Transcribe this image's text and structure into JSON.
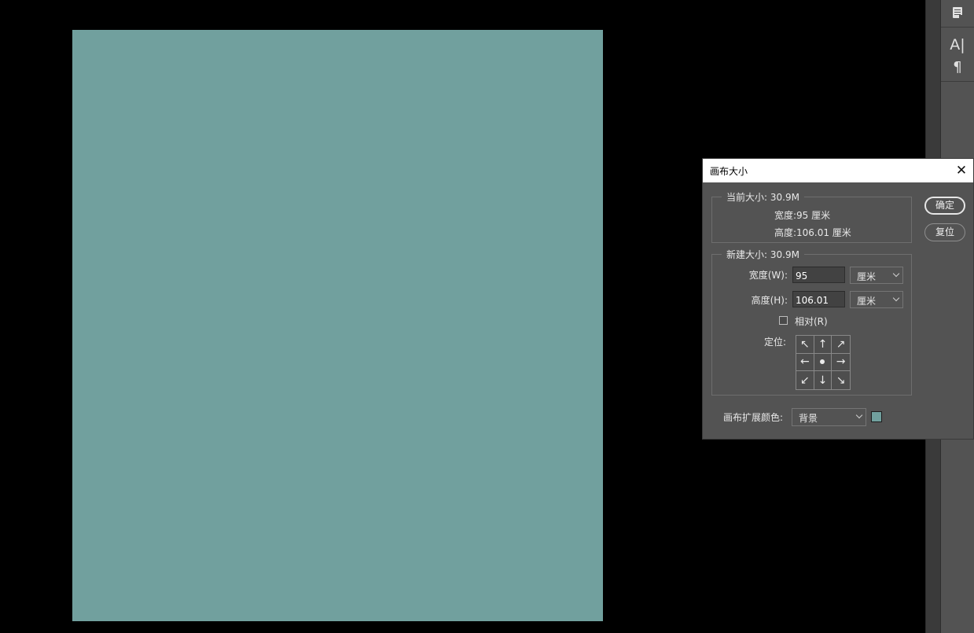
{
  "document": {
    "canvas_color": "#71a09e"
  },
  "panel_dock": {
    "buttons": [
      {
        "name": "notes-icon"
      },
      {
        "name": "character-icon",
        "glyph": "A|"
      },
      {
        "name": "paragraph-icon",
        "glyph": "¶"
      }
    ]
  },
  "dialog": {
    "title": "画布大小",
    "close_glyph": "✕",
    "current": {
      "legend": "当前大小: 30.9M",
      "width_label": "宽度:",
      "width_value": "95 厘米",
      "height_label": "高度:",
      "height_value": "106.01 厘米"
    },
    "new_size": {
      "legend": "新建大小: 30.9M",
      "width_label": "宽度(W):",
      "width_value": "95",
      "width_unit": "厘米",
      "height_label": "高度(H):",
      "height_value": "106.01",
      "height_unit": "厘米",
      "relative_label": "相对(R)",
      "relative_checked": false,
      "anchor_label": "定位:",
      "anchor_arrows": [
        "↖",
        "↑",
        "↗",
        "←",
        "",
        "→",
        "↙",
        "↓",
        "↘"
      ]
    },
    "extension": {
      "label": "画布扩展颜色:",
      "value": "背景",
      "swatch_color": "#71a09e"
    },
    "buttons": {
      "ok": "确定",
      "reset": "复位"
    }
  }
}
